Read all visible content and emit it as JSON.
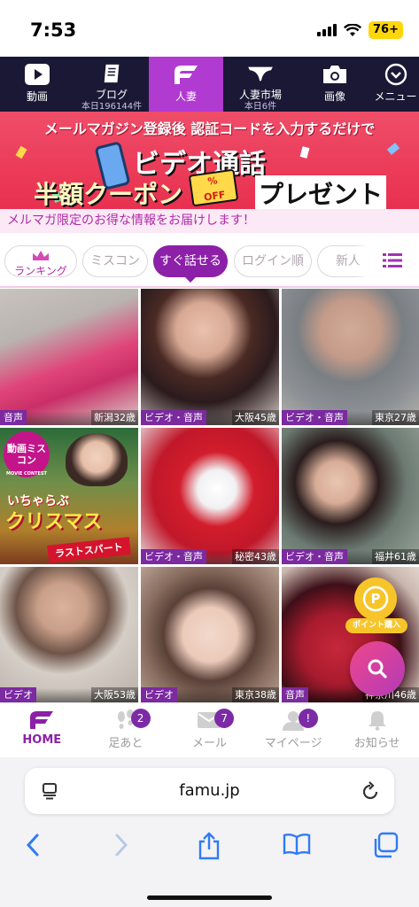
{
  "status_bar": {
    "time": "7:53",
    "battery": "76+"
  },
  "top_nav": {
    "items": [
      {
        "label": "動画",
        "sub": "",
        "icon": "play-icon"
      },
      {
        "label": "ブログ",
        "sub": "本日196144件",
        "icon": "notebook-icon"
      },
      {
        "label": "人妻",
        "sub": "",
        "icon": "famu-logo-icon"
      },
      {
        "label": "人妻市場",
        "sub": "本日6件",
        "icon": "lingerie-icon"
      },
      {
        "label": "画像",
        "sub": "",
        "icon": "camera-icon"
      },
      {
        "label": "メニュー",
        "sub": "",
        "icon": "chevron-down-circle-icon"
      }
    ],
    "active_index": 2
  },
  "banner": {
    "line1": "メールマガジン登録後 認証コードを入力するだけで",
    "line2": "ビデオ通話",
    "coupon": "半額クーポン",
    "present": "プレゼント",
    "ticket_percent": "%",
    "ticket_off": "OFF"
  },
  "notice": "メルマガ限定のお得な情報をお届けします！",
  "filters": {
    "items": [
      "ランキング",
      "ミスコン",
      "すぐ話せる",
      "ログイン順",
      "新人"
    ],
    "active": "すぐ話せる"
  },
  "cards": [
    {
      "tag": "音声",
      "info": "新潟32歳"
    },
    {
      "tag": "ビデオ・音声",
      "info": "大阪45歳"
    },
    {
      "tag": "ビデオ・音声",
      "info": "東京27歳"
    },
    {
      "tag": "",
      "info": "",
      "promo": {
        "badge": "動画ミスコン",
        "badge_sub": "MOVIE CONTEST",
        "title_small": "いちゃらぶ",
        "title": "クリスマス",
        "ribbon": "ラストスパート"
      }
    },
    {
      "tag": "ビデオ・音声",
      "info": "秘密43歳"
    },
    {
      "tag": "ビデオ・音声",
      "info": "福井61歳"
    },
    {
      "tag": "ビデオ",
      "info": "大阪53歳"
    },
    {
      "tag": "ビデオ",
      "info": "東京38歳"
    },
    {
      "tag": "音声",
      "info": "神奈川46歳"
    }
  ],
  "fabs": {
    "point_label": "ポイント購入",
    "point_symbol": "P"
  },
  "bottom_nav": {
    "items": [
      {
        "label": "HOME",
        "badge": ""
      },
      {
        "label": "足あと",
        "badge": "2"
      },
      {
        "label": "メール",
        "badge": "7"
      },
      {
        "label": "マイページ",
        "badge": "!"
      },
      {
        "label": "お知らせ",
        "badge": ""
      }
    ]
  },
  "browser": {
    "url": "famu.jp"
  },
  "colors": {
    "nav_bg": "#1b1835",
    "accent": "#b13ad1",
    "purple": "#8c20a8",
    "banner": "#e8304f",
    "point": "#f7c52a"
  }
}
